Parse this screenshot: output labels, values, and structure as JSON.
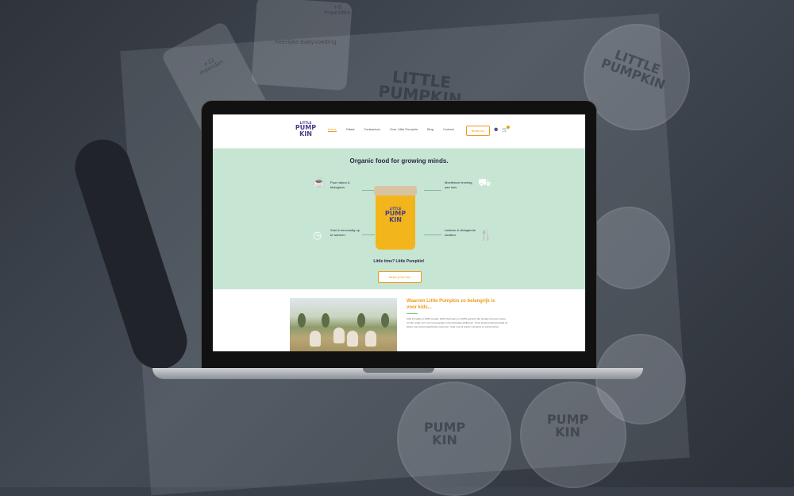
{
  "background": {
    "brand_on_lids": [
      "LITTLE PUMPKIN",
      "LITTLE PUMPKIN",
      "PUMP KIN",
      "PUMP KIN"
    ],
    "jar_labels": [
      "+8 maanden",
      "+12 maanden",
      "heerlijke babyvoeding"
    ]
  },
  "site": {
    "logo": {
      "top": "LITTLE",
      "line1": "PUMP",
      "line2": "KIN"
    },
    "menu": [
      {
        "label": "Home",
        "active": true
      },
      {
        "label": "Tafaal",
        "active": false
      },
      {
        "label": "Cadeaubon",
        "active": false
      },
      {
        "label": "Over Little Pumpkin",
        "active": false
      },
      {
        "label": "Blog",
        "active": false
      },
      {
        "label": "Contact",
        "active": false
      }
    ],
    "top_cta": "Bestel hier",
    "accent_color": "#f29a1a",
    "brand_color": "#4a3f8c",
    "hero_bg": "#c6e5d2"
  },
  "hero": {
    "title": "Organic food for growing minds.",
    "features": {
      "top_left": "Puur natuur & biologisch",
      "top_right": "Moeiteloze levering aan huis",
      "bottom_left": "Snel & eenvoudig op te warmen",
      "bottom_right": "Lekkere & uitdagende smaken"
    },
    "jar": {
      "top": "LITTLE",
      "line1": "PUMP",
      "line2": "KIN"
    },
    "subtitle": "Little time? Little Pumpkin!",
    "cta": "Bestel je box hier"
  },
  "why": {
    "title": "Waarom Little Pumpkin zo belangrijk is voor kids...",
    "body": "Little Pumpkin is 100% smaak, 100% duurzaam en 100% gezond. We houden het puur natuur, zonder enige vorm van toevoegingen of kunstmatige additieven. Onze kindervoeding bestaat uit lekker veel seizoensgebonden groenten, maar ook uit granen, spinazie en peulvruchten."
  }
}
